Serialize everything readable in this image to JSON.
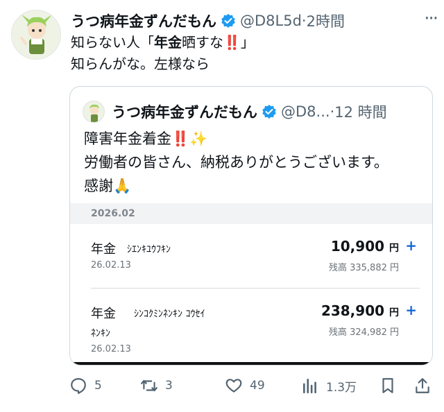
{
  "post": {
    "author_name": "うつ病年金ずんだもん",
    "handle": "@D8L5d",
    "separator": "·",
    "time": "2時間",
    "more_label": "···",
    "text_line1_a": "知らない人「",
    "text_line1_bold": "年金",
    "text_line1_b": "晒すな",
    "text_line1_emoji": "‼️",
    "text_line1_c": "」",
    "text_line2": "知らんがな。左様なら"
  },
  "quote": {
    "author_name": "うつ病年金ずんだもん",
    "handle": "@D8...",
    "separator": "·",
    "time": "12 時間",
    "line1": "障害年金着金",
    "line1_emoji1": "‼️",
    "line1_emoji2": "✨",
    "line2": "労働者の皆さん、納税ありがとうございます。",
    "line3": "感謝",
    "line3_emoji": "🙏"
  },
  "media": {
    "date_header": "2026.02",
    "rows": [
      {
        "type": "年金",
        "desc_line1": "ｼｴﾝｷﾕｳﾌｷﾝ",
        "desc_line2": "",
        "date": "26.02.13",
        "amount": "10,900",
        "currency": "円",
        "plus": "+",
        "balance": "残高 335,882 円"
      },
      {
        "type": "年金",
        "desc_line1": "ｼﾝｺｸﾐﾝﾈﾝｷﾝ ｺｳｾｲ",
        "desc_line2": "ﾈﾝｷﾝ",
        "date": "26.02.13",
        "amount": "238,900",
        "currency": "円",
        "plus": "+",
        "balance": "残高 324,982 円"
      }
    ]
  },
  "actions": {
    "reply_count": "5",
    "retweet_count": "3",
    "like_count": "49",
    "views_count": "1.3万",
    "colors": {
      "icon": "#536471",
      "verified": "#1d9bf0",
      "plus": "#1967d2",
      "emoji_red": "#e0102e"
    }
  }
}
